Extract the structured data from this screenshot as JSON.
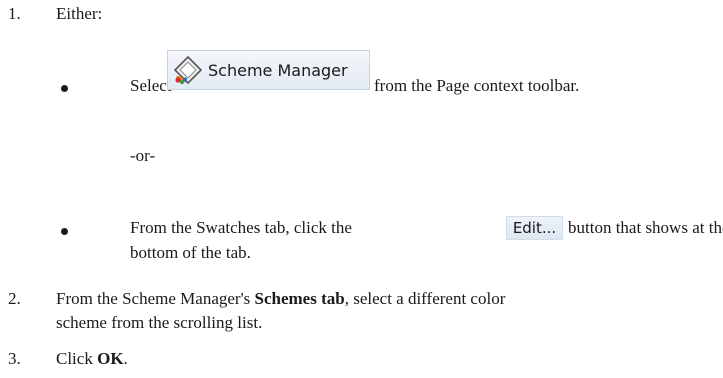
{
  "steps": [
    {
      "number": "1.",
      "text": "Either:"
    },
    {
      "number": "2.",
      "line1_pre": "From the Scheme Manager's ",
      "line1_bold": "Schemes tab",
      "line1_post": ", select a different color",
      "line2": "scheme from the scrolling list."
    },
    {
      "number": "3.",
      "pre": "Click ",
      "bold": "OK",
      "post": "."
    }
  ],
  "option_a": {
    "pre": "Select",
    "button_label": "Scheme Manager",
    "button_icon": "scheme-manager-icon",
    "post": "from the Page context toolbar."
  },
  "or_text": "-or-",
  "option_b": {
    "pre": "From the Swatches tab, click the",
    "button_label": "Edit...",
    "post": "button that shows at the",
    "line2": "bottom of the tab."
  }
}
